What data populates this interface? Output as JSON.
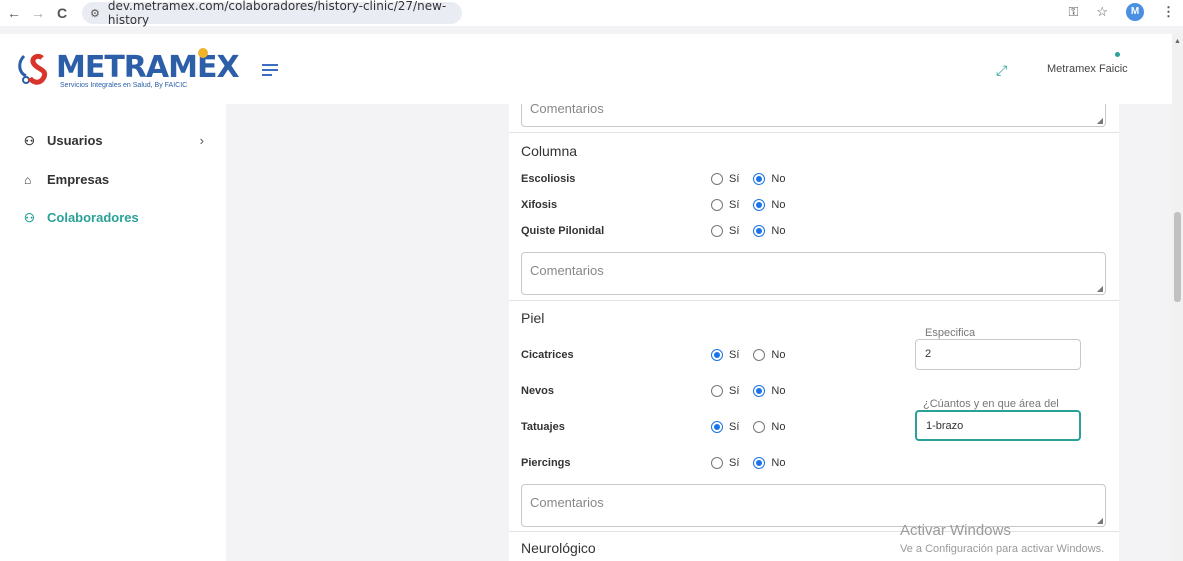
{
  "browser": {
    "url": "dev.metramex.com/colaboradores/history-clinic/27/new-history",
    "back": "←",
    "forward": "→",
    "reload": "C",
    "profile_initial": "M"
  },
  "header": {
    "logo_text": "METRAMEX",
    "logo_subtitle": "Servicios Integrales en Salud, By FAICIC",
    "user_name": "Metramex Faicic"
  },
  "sidebar": {
    "items": [
      {
        "label": "Usuarios",
        "icon": "person-icon",
        "active": false
      },
      {
        "label": "Empresas",
        "icon": "building-icon",
        "active": false
      },
      {
        "label": "Colaboradores",
        "icon": "people-icon",
        "active": true
      }
    ]
  },
  "form": {
    "top_comment_placeholder": "Comentarios",
    "columna": {
      "title": "Columna",
      "fields": [
        {
          "label": "Escoliosis",
          "yes": "Sí",
          "no": "No",
          "value": "No"
        },
        {
          "label": "Xifosis",
          "yes": "Sí",
          "no": "No",
          "value": "No"
        },
        {
          "label": "Quiste Pilonidal",
          "yes": "Sí",
          "no": "No",
          "value": "No"
        }
      ],
      "comment_placeholder": "Comentarios"
    },
    "piel": {
      "title": "Piel",
      "fields": [
        {
          "label": "Cicatrices",
          "yes": "Sí",
          "no": "No",
          "value": "Sí"
        },
        {
          "label": "Nevos",
          "yes": "Sí",
          "no": "No",
          "value": "No"
        },
        {
          "label": "Tatuajes",
          "yes": "Sí",
          "no": "No",
          "value": "Sí"
        },
        {
          "label": "Piercings",
          "yes": "Sí",
          "no": "No",
          "value": "No"
        }
      ],
      "especifica_label": "Especifica",
      "especifica_value": "2",
      "tatuajes_label": "¿Cúantos y en que área del cuerpo?",
      "tatuajes_value": "1-brazo",
      "comment_placeholder": "Comentarios"
    },
    "neuro": {
      "title": "Neurológico"
    }
  },
  "watermark": {
    "line1": "Activar Windows",
    "line2": "Ve a Configuración para activar Windows."
  }
}
